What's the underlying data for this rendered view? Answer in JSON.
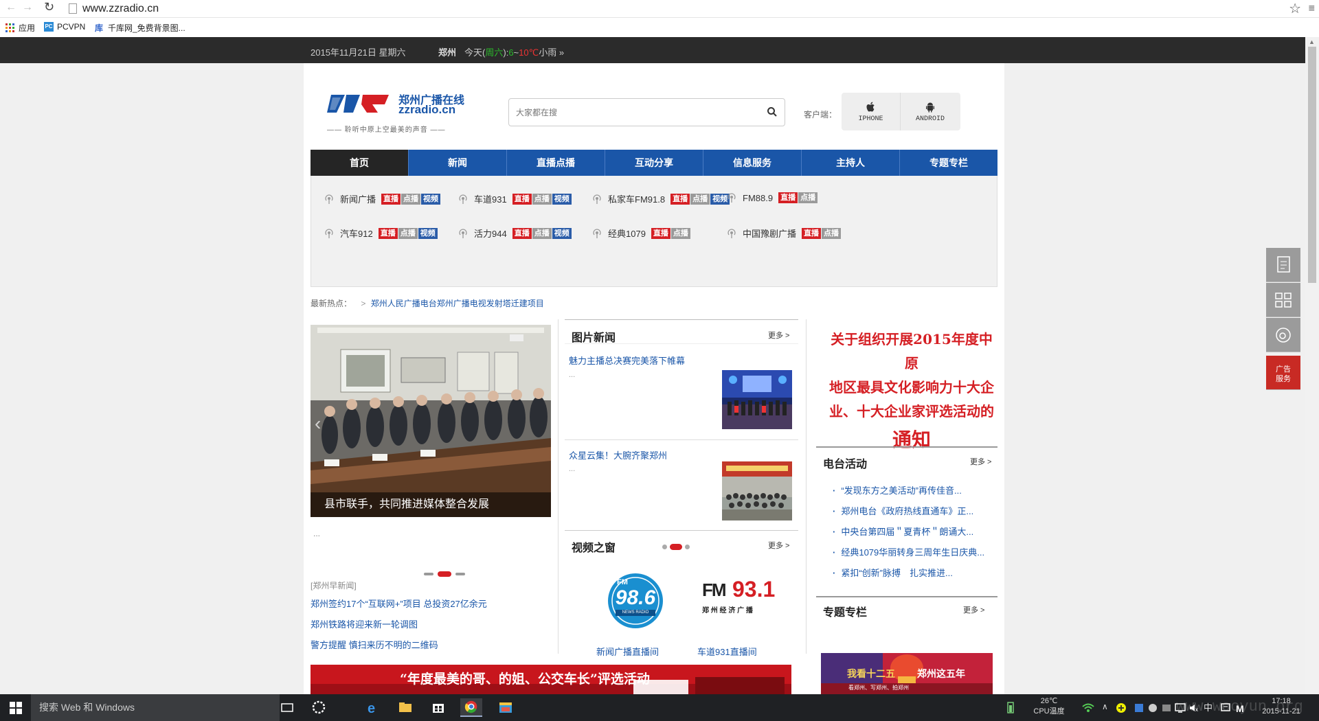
{
  "browser": {
    "url": "www.zzradio.cn",
    "bookmarks": [
      "应用",
      "PCVPN",
      "千库网_免费背景图..."
    ]
  },
  "topbar": {
    "date": "2015年11月21日 星期六",
    "city": "郑州",
    "weather_prefix": "今天(",
    "weather_day": "周六",
    "weather_mid": "):",
    "temp_low": "6",
    "temp_sep": "~",
    "temp_high": "10℃",
    "weather_desc": "小雨",
    "weather_more": "»"
  },
  "header": {
    "logo_cn": "郑州广播在线",
    "logo_en": "zzradio.cn",
    "slogan": "—— 聆听中原上空最美的声音 ——",
    "search_placeholder": "大家都在搜",
    "client_label": "客户端：",
    "client_iphone": "IPHONE",
    "client_android": "ANDROID"
  },
  "nav": [
    "首页",
    "新闻",
    "直播点播",
    "互动分享",
    "信息服务",
    "主持人",
    "专题专栏"
  ],
  "stations_row1": [
    {
      "name": "新闻广播",
      "tags": [
        "直播",
        "点播",
        "视频"
      ]
    },
    {
      "name": "车道931",
      "tags": [
        "直播",
        "点播",
        "视频"
      ]
    },
    {
      "name": "私家车FM91.8",
      "tags": [
        "直播",
        "点播",
        "视频"
      ]
    },
    {
      "name": "FM88.9",
      "tags": [
        "直播",
        "点播"
      ]
    }
  ],
  "stations_row2": [
    {
      "name": "汽车912",
      "tags": [
        "直播",
        "点播",
        "视频"
      ]
    },
    {
      "name": "活力944",
      "tags": [
        "直播",
        "点播",
        "视频"
      ]
    },
    {
      "name": "经典1079",
      "tags": [
        "直播",
        "点播"
      ]
    },
    {
      "name": "中国豫剧广播",
      "tags": [
        "直播",
        "点播"
      ]
    }
  ],
  "hot": {
    "label": "最新热点：",
    "chev": ">",
    "link": "郑州人民广播电台郑州广播电视发射塔迁建项目"
  },
  "slider": {
    "caption": "县市联手，共同推进媒体整合发展",
    "ellipsis": "...",
    "prev": "‹"
  },
  "left_news": {
    "source": "[郑州早新闻]",
    "items": [
      "郑州签约17个“互联网+”项目 总投资27亿余元",
      "郑州铁路将迎来新一轮调图",
      "警方提醒 慎扫来历不明的二维码"
    ]
  },
  "photo_news": {
    "title": "图片新闻",
    "more": "更多 >",
    "items": [
      {
        "title": "魅力主播总决赛完美落下帷幕",
        "desc": "..."
      },
      {
        "title": "众星云集！大腕齐聚郑州",
        "desc": "..."
      }
    ]
  },
  "video_window": {
    "title": "视频之窗",
    "more": "更多 >",
    "items": [
      {
        "caption": "新闻广播直播间",
        "logo_fm": "FM",
        "logo_num": "98.6",
        "logo_sub": "NEWS RADIO"
      },
      {
        "caption": "车道931直播间",
        "logo_fm": "FM",
        "logo_num": "93.1",
        "logo_sub": "郑 州 经 济 广 播"
      }
    ]
  },
  "notice": {
    "lines": [
      "关于组织开展2015年度中原",
      "地区最具文化影响力十大企",
      "业、十大企业家评选活动的"
    ],
    "big": "通知"
  },
  "activities": {
    "title": "电台活动",
    "more": "更多 >",
    "items": [
      "“发现东方之美活动”再传佳音...",
      "郑州电台《政府热线直通车》正...",
      "中央台第四届＂夏青杯＂朗诵大...",
      "经典1079华丽转身三周年生日庆典...",
      "紧扣“创新”脉搏　扎实推进..."
    ]
  },
  "topics": {
    "title": "专题专栏",
    "more": "更多 >",
    "banner_left": "我看十二五",
    "banner_right": "郑州这五年",
    "banner_sub": "看郑州、写郑州、拍郑州"
  },
  "bottom_banner": {
    "text": "“年度最美的哥、的姐、公交车长”评选活动"
  },
  "side_float": {
    "ad_label_1": "广告",
    "ad_label_2": "服务"
  },
  "taskbar": {
    "search": "搜索 Web 和 Windows",
    "temp": "26℃",
    "cpu": "CPU温度",
    "time": "17:18",
    "date": "2015-11-21",
    "ime": "中",
    "watermark": "www.wooyun.org"
  },
  "colors": {
    "nav_blue": "#1a56a8",
    "live_red": "#d51f24",
    "topbar_dark": "#2b2b2b"
  }
}
